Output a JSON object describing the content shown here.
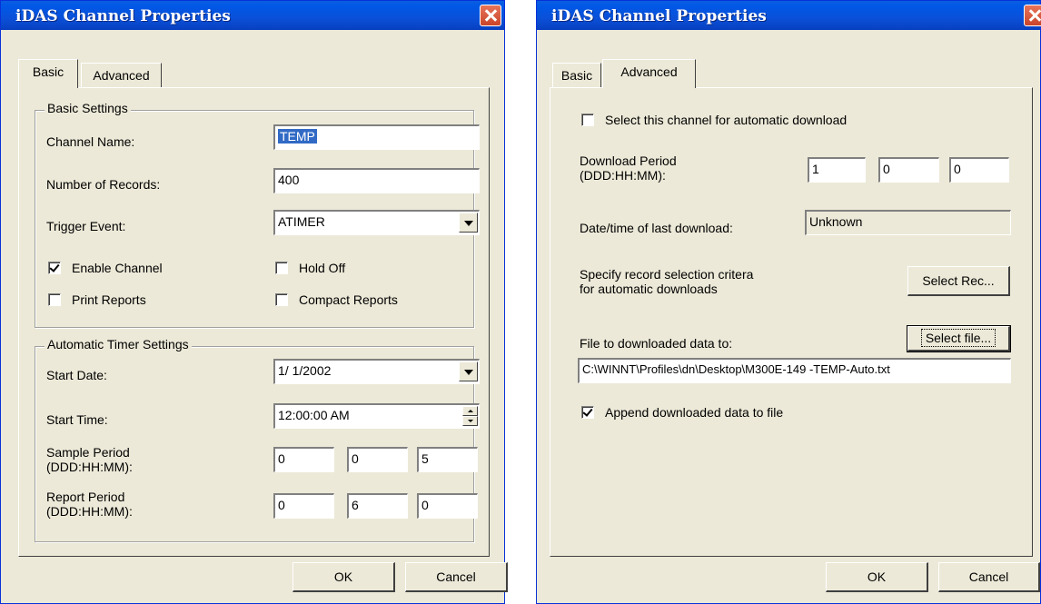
{
  "left_dialog": {
    "title": "iDAS Channel Properties",
    "tabs": [
      {
        "label": "Basic",
        "active": true
      },
      {
        "label": "Advanced",
        "active": false
      }
    ],
    "basic_settings": {
      "group_label": "Basic Settings",
      "channel_name_label": "Channel Name:",
      "channel_name_value": "TEMP",
      "num_records_label": "Number of Records:",
      "num_records_value": "400",
      "trigger_event_label": "Trigger Event:",
      "trigger_event_value": "ATIMER",
      "enable_channel_label": "Enable Channel",
      "enable_channel_checked": true,
      "hold_off_label": "Hold Off",
      "hold_off_checked": false,
      "print_reports_label": "Print Reports",
      "print_reports_checked": false,
      "compact_reports_label": "Compact Reports",
      "compact_reports_checked": false
    },
    "timer_settings": {
      "group_label": "Automatic Timer Settings",
      "start_date_label": "Start Date:",
      "start_date_value": "1/ 1/2002",
      "start_time_label": "Start Time:",
      "start_time_value": "12:00:00 AM",
      "sample_period_label": "Sample Period",
      "sample_period_format": "(DDD:HH:MM):",
      "sample_period_values": [
        "0",
        "0",
        "5"
      ],
      "report_period_label": "Report Period",
      "report_period_format": "(DDD:HH:MM):",
      "report_period_values": [
        "0",
        "6",
        "0"
      ]
    },
    "ok_label": "OK",
    "cancel_label": "Cancel"
  },
  "right_dialog": {
    "title": "iDAS Channel Properties",
    "tabs": [
      {
        "label": "Basic",
        "active": false
      },
      {
        "label": "Advanced",
        "active": true
      }
    ],
    "auto_download_label": "Select this channel for automatic download",
    "auto_download_checked": false,
    "download_period_label": "Download Period",
    "download_period_format": "(DDD:HH:MM):",
    "download_period_values": [
      "1",
      "0",
      "0"
    ],
    "last_download_label": "Date/time of last download:",
    "last_download_value": "Unknown",
    "record_criteria_label_1": "Specify record selection critera",
    "record_criteria_label_2": "for automatic downloads",
    "select_rec_label": "Select Rec...",
    "file_label": "File to downloaded data to:",
    "select_file_label": "Select file...",
    "file_path": "C:\\WINNT\\Profiles\\dn\\Desktop\\M300E-149 -TEMP-Auto.txt",
    "append_label": "Append downloaded data to file",
    "append_checked": true,
    "ok_label": "OK",
    "cancel_label": "Cancel"
  }
}
